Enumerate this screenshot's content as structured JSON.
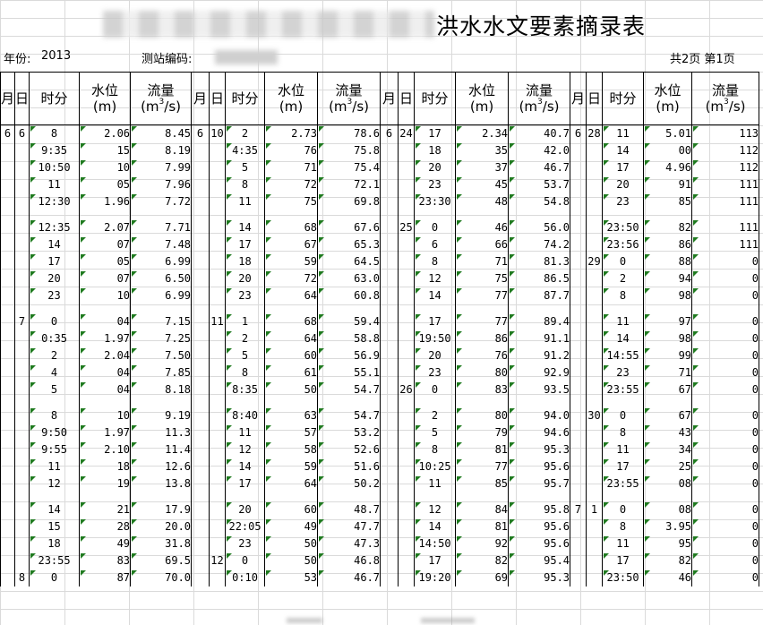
{
  "title": {
    "text": "洪水水文要素摘录表"
  },
  "info": {
    "year_label": "年份:",
    "year": "2013",
    "station_label": "测站编码:",
    "pages": "共2页 第1页"
  },
  "headers": {
    "month": "月",
    "day": "日",
    "time": "时分",
    "level": "水位",
    "level_unit": "(m)",
    "flow": "流量",
    "flow_unit_a": "(m",
    "flow_unit_sup": "3",
    "flow_unit_b": "/s)"
  },
  "markers": {
    "green": "#1f7a1f"
  },
  "rows": [
    [
      [
        "6",
        "6",
        "8",
        "2.06",
        "8.45"
      ],
      [
        "6",
        "10",
        "2",
        "2.73",
        "78.6"
      ],
      [
        "6",
        "24",
        "17",
        "2.34",
        "40.7"
      ],
      [
        "6",
        "28",
        "11",
        "5.01",
        "113"
      ]
    ],
    [
      [
        "",
        "",
        "9:35",
        "15",
        "8.19"
      ],
      [
        "",
        "",
        "4:35",
        "76",
        "75.8"
      ],
      [
        "",
        "",
        "18",
        "35",
        "42.0"
      ],
      [
        "",
        "",
        "14",
        "00",
        "112"
      ]
    ],
    [
      [
        "",
        "",
        "10:50",
        "10",
        "7.99"
      ],
      [
        "",
        "",
        "5",
        "71",
        "75.4"
      ],
      [
        "",
        "",
        "20",
        "37",
        "46.7"
      ],
      [
        "",
        "",
        "17",
        "4.96",
        "112"
      ]
    ],
    [
      [
        "",
        "",
        "11",
        "05",
        "7.96"
      ],
      [
        "",
        "",
        "8",
        "72",
        "72.1"
      ],
      [
        "",
        "",
        "23",
        "45",
        "53.7"
      ],
      [
        "",
        "",
        "20",
        "91",
        "111"
      ]
    ],
    [
      [
        "",
        "",
        "12:30",
        "1.96",
        "7.72"
      ],
      [
        "",
        "",
        "11",
        "75",
        "69.8"
      ],
      [
        "",
        "",
        "23:30",
        "48",
        "54.8"
      ],
      [
        "",
        "",
        "23",
        "85",
        "111"
      ]
    ],
    "gap",
    [
      [
        "",
        "",
        "12:35",
        "2.07",
        "7.71"
      ],
      [
        "",
        "",
        "14",
        "68",
        "67.6"
      ],
      [
        "",
        "25",
        "0",
        "46",
        "56.0"
      ],
      [
        "",
        "",
        "23:50",
        "82",
        "111"
      ]
    ],
    [
      [
        "",
        "",
        "14",
        "07",
        "7.48"
      ],
      [
        "",
        "",
        "17",
        "67",
        "65.3"
      ],
      [
        "",
        "",
        "6",
        "66",
        "74.2"
      ],
      [
        "",
        "",
        "23:56",
        "86",
        "111"
      ]
    ],
    [
      [
        "",
        "",
        "17",
        "05",
        "6.99"
      ],
      [
        "",
        "",
        "18",
        "59",
        "64.5"
      ],
      [
        "",
        "",
        "8",
        "71",
        "81.3"
      ],
      [
        "",
        "29",
        "0",
        "88",
        "0"
      ]
    ],
    [
      [
        "",
        "",
        "20",
        "07",
        "6.50"
      ],
      [
        "",
        "",
        "20",
        "72",
        "63.0"
      ],
      [
        "",
        "",
        "12",
        "75",
        "86.5"
      ],
      [
        "",
        "",
        "2",
        "94",
        "0"
      ]
    ],
    [
      [
        "",
        "",
        "23",
        "10",
        "6.99"
      ],
      [
        "",
        "",
        "23",
        "64",
        "60.8"
      ],
      [
        "",
        "",
        "14",
        "77",
        "87.7"
      ],
      [
        "",
        "",
        "8",
        "98",
        "0"
      ]
    ],
    "gap",
    [
      [
        "",
        "7",
        "0",
        "04",
        "7.15"
      ],
      [
        "",
        "11",
        "1",
        "68",
        "59.4"
      ],
      [
        "",
        "",
        "17",
        "77",
        "89.4"
      ],
      [
        "",
        "",
        "11",
        "97",
        "0"
      ]
    ],
    [
      [
        "",
        "",
        "0:35",
        "1.97",
        "7.25"
      ],
      [
        "",
        "",
        "2",
        "64",
        "58.8"
      ],
      [
        "",
        "",
        "19:50",
        "86",
        "91.1"
      ],
      [
        "",
        "",
        "14",
        "98",
        "0"
      ]
    ],
    [
      [
        "",
        "",
        "2",
        "2.04",
        "7.50"
      ],
      [
        "",
        "",
        "5",
        "60",
        "56.9"
      ],
      [
        "",
        "",
        "20",
        "76",
        "91.2"
      ],
      [
        "",
        "",
        "14:55",
        "99",
        "0"
      ]
    ],
    [
      [
        "",
        "",
        "4",
        "04",
        "7.85"
      ],
      [
        "",
        "",
        "8",
        "61",
        "55.1"
      ],
      [
        "",
        "",
        "23",
        "80",
        "92.9"
      ],
      [
        "",
        "",
        "23",
        "71",
        "0"
      ]
    ],
    [
      [
        "",
        "",
        "5",
        "04",
        "8.18"
      ],
      [
        "",
        "",
        "8:35",
        "50",
        "54.7"
      ],
      [
        "",
        "26",
        "0",
        "83",
        "93.5"
      ],
      [
        "",
        "",
        "23:55",
        "67",
        "0"
      ]
    ],
    "gap",
    [
      [
        "",
        "",
        "8",
        "10",
        "9.19"
      ],
      [
        "",
        "",
        "8:40",
        "63",
        "54.7"
      ],
      [
        "",
        "",
        "2",
        "80",
        "94.0"
      ],
      [
        "",
        "30",
        "0",
        "67",
        "0"
      ]
    ],
    [
      [
        "",
        "",
        "9:50",
        "1.97",
        "11.3"
      ],
      [
        "",
        "",
        "11",
        "57",
        "53.2"
      ],
      [
        "",
        "",
        "5",
        "79",
        "94.6"
      ],
      [
        "",
        "",
        "8",
        "43",
        "0"
      ]
    ],
    [
      [
        "",
        "",
        "9:55",
        "2.10",
        "11.4"
      ],
      [
        "",
        "",
        "12",
        "58",
        "52.6"
      ],
      [
        "",
        "",
        "8",
        "81",
        "95.3"
      ],
      [
        "",
        "",
        "11",
        "34",
        "0"
      ]
    ],
    [
      [
        "",
        "",
        "11",
        "18",
        "12.6"
      ],
      [
        "",
        "",
        "14",
        "59",
        "51.6"
      ],
      [
        "",
        "",
        "10:25",
        "77",
        "95.6"
      ],
      [
        "",
        "",
        "17",
        "25",
        "0"
      ]
    ],
    [
      [
        "",
        "",
        "12",
        "19",
        "13.8"
      ],
      [
        "",
        "",
        "17",
        "64",
        "50.2"
      ],
      [
        "",
        "",
        "11",
        "85",
        "95.7"
      ],
      [
        "",
        "",
        "23:55",
        "08",
        "0"
      ]
    ],
    "gap",
    [
      [
        "",
        "",
        "14",
        "21",
        "17.9"
      ],
      [
        "",
        "",
        "20",
        "60",
        "48.7"
      ],
      [
        "",
        "",
        "12",
        "84",
        "95.8"
      ],
      [
        "7",
        "1",
        "0",
        "08",
        "0"
      ]
    ],
    [
      [
        "",
        "",
        "15",
        "28",
        "20.0"
      ],
      [
        "",
        "",
        "22:05",
        "49",
        "47.7"
      ],
      [
        "",
        "",
        "14",
        "81",
        "95.6"
      ],
      [
        "",
        "",
        "8",
        "3.95",
        "0"
      ]
    ],
    [
      [
        "",
        "",
        "18",
        "49",
        "31.8"
      ],
      [
        "",
        "",
        "23",
        "50",
        "47.3"
      ],
      [
        "",
        "",
        "14:50",
        "92",
        "95.6"
      ],
      [
        "",
        "",
        "11",
        "95",
        "0"
      ]
    ],
    [
      [
        "",
        "",
        "23:55",
        "83",
        "69.5"
      ],
      [
        "",
        "12",
        "0",
        "50",
        "46.8"
      ],
      [
        "",
        "",
        "17",
        "82",
        "95.4"
      ],
      [
        "",
        "",
        "17",
        "82",
        "0"
      ]
    ],
    [
      [
        "",
        "8",
        "0",
        "87",
        "70.0"
      ],
      [
        "",
        "",
        "0:10",
        "53",
        "46.7"
      ],
      [
        "",
        "",
        "19:20",
        "69",
        "95.3"
      ],
      [
        "",
        "",
        "23:50",
        "46",
        "0"
      ]
    ]
  ]
}
